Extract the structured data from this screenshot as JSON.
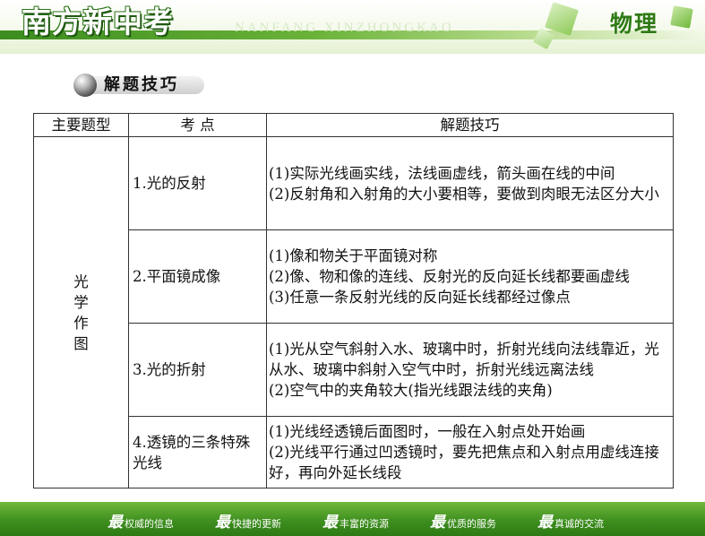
{
  "header": {
    "brand": "南方新中考",
    "pinyin": "NANFANG XINZHONGKAO",
    "subject": "物理",
    "accent": "#3c8d1e"
  },
  "section": {
    "title": "解题技巧"
  },
  "table": {
    "headers": [
      "主要题型",
      "考 点",
      "解题技巧"
    ],
    "type": "光学作图",
    "rows": [
      {
        "topic": "1.光的反射",
        "tips": [
          "(1)实际光线画实线，法线画虚线，箭头画在线的中间",
          "(2)反射角和入射角的大小要相等，要做到肉眼无法区分大小"
        ]
      },
      {
        "topic": "2.平面镜成像",
        "tips": [
          "(1)像和物关于平面镜对称",
          "(2)像、物和像的连线、反射光的反向延长线都要画虚线",
          "(3)任意一条反射光线的反向延长线都经过像点"
        ]
      },
      {
        "topic": "3.光的折射",
        "tips": [
          "(1)光从空气斜射入水、玻璃中时，折射光线向法线靠近，光从水、玻璃中斜射入空气中时，折射光线远离法线",
          "(2)空气中的夹角较大(指光线跟法线的夹角)"
        ]
      },
      {
        "topic": "4.透镜的三条特殊光线",
        "tips": [
          "(1)光线经透镜后面图时，一般在入射点处开始画",
          "(2)光线平行通过凹透镜时，要先把焦点和入射点用虚线连接好，再向外延长线段"
        ]
      }
    ]
  },
  "footer": {
    "items": [
      {
        "big": "最",
        "small": "权威的信息"
      },
      {
        "big": "最",
        "small": "快捷的更新"
      },
      {
        "big": "最",
        "small": "丰富的资源"
      },
      {
        "big": "最",
        "small": "优质的服务"
      },
      {
        "big": "最",
        "small": "真诚的交流"
      }
    ]
  }
}
